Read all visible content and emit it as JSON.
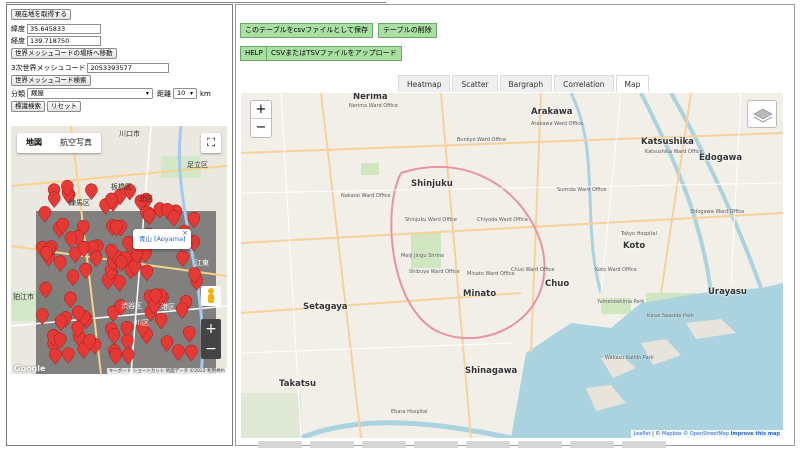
{
  "left": {
    "current_location_button": "現在地を取得する",
    "latitude_label": "緯度",
    "latitude_value": "35.645833",
    "longitude_label": "経度",
    "longitude_value": "139.718750",
    "move_to_mesh_button": "世界メッシュコードの場所へ移動",
    "mesh3_label": "3次世界メッシュコード",
    "mesh3_value": "2053393577",
    "mesh_search_button": "世界メッシュコード検索",
    "category_label": "分類",
    "category_value": "厩屋",
    "distance_label": "距離",
    "distance_value": "10",
    "distance_unit": "km",
    "search_button": "標識検索",
    "reset_button": "リセット",
    "map": {
      "tab_map": "地図",
      "tab_satellite": "航空写真",
      "infowindow": "青山 [Aoyama]",
      "close": "×",
      "zoom_in": "+",
      "zoom_out": "−",
      "labels": [
        "川口市",
        "足立区",
        "板橋区",
        "北区",
        "練馬区",
        "江東",
        "渋谷区",
        "港区",
        "川区",
        "狛江市"
      ],
      "logo": "Google",
      "footer": "キーボード ショートカット  地図データ ©2022  利用規約"
    }
  },
  "right": {
    "save_csv_button": "このテーブルをcsvファイルとして保存",
    "table_delete_button": "テーブルの削除",
    "help_button": "HELP",
    "upload_button": "CSVまたはTSVファイルをアップロード",
    "tabs": [
      "Heatmap",
      "Scatter",
      "Bargraph",
      "Correlation",
      "Map"
    ],
    "active_tab": "Map",
    "map": {
      "zoom_in": "+",
      "zoom_out": "−",
      "places": {
        "nerima": "Nerima",
        "arakawa": "Arakawa",
        "katsushika": "Katsushika",
        "edogawa": "Edogawa",
        "shinjuku": "Shinjuku",
        "koto": "Koto",
        "setagaya": "Setagaya",
        "minato": "Minato",
        "chuo": "Chuo",
        "urayasu": "Urayasu",
        "shinagawa": "Shinagawa",
        "takatsu": "Takatsu"
      },
      "small_labels": {
        "nerima_ward": "Nerima Ward Office",
        "bunkyo_ward": "Bunkyo Ward Office",
        "arakawa_ward": "Arakawa Ward Office",
        "katsushika_ward": "Katsushika Ward Office",
        "nakano_ward": "Nakano Ward Office",
        "shinjuku_ward": "Shinjuku Ward Office",
        "chiyoda_ward": "Chiyoda Ward Office",
        "sumida_ward": "Sumida Ward Office",
        "edogawa_ward": "Edogawa Ward Office",
        "meiji_shrine": "Meiji Jingu Shrine",
        "chuo_ward": "Chuo Ward Office",
        "koto_ward": "Koto Ward Office",
        "shibuya_ward": "Shibuya Ward Office",
        "minato_ward": "Minato Ward Office",
        "yumenoshima": "Yumenoshima Park",
        "kasai_park": "Kasai Seaside Park",
        "wakasu_park": "Wakasu Kaihin Park",
        "ebara_hospital": "Ebara Hospital",
        "tokyo_hospital": "Tokyo Hospital"
      },
      "attribution": {
        "leaflet": "Leaflet",
        "sep": " | © ",
        "mapbox": "Mapbox",
        "osm": "© OpenStreetMap",
        "improve": "Improve this map"
      }
    }
  }
}
